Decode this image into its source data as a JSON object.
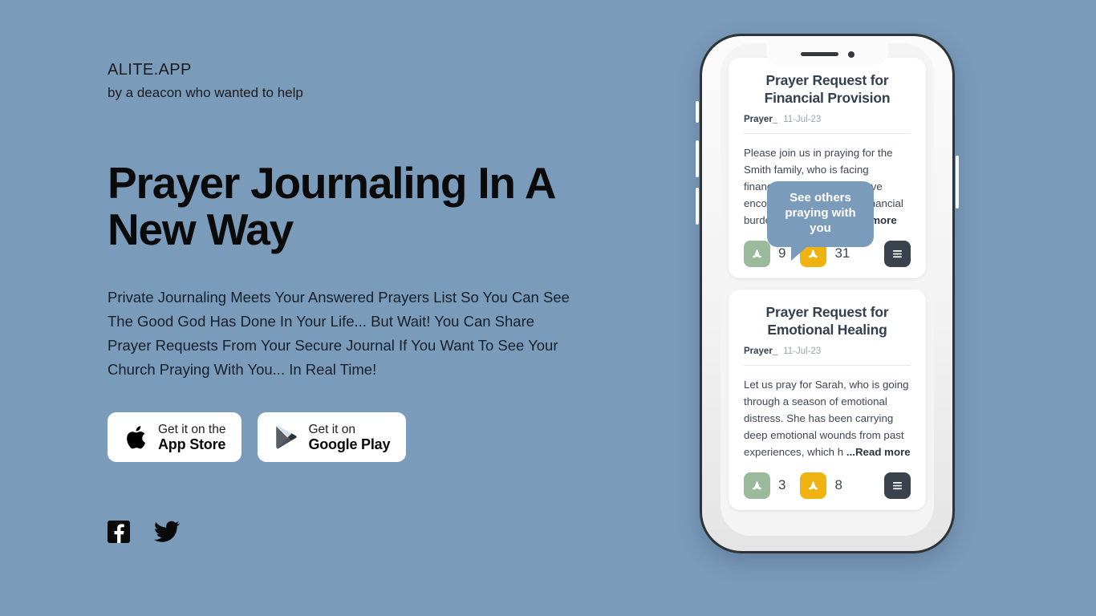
{
  "brand": {
    "name": "ALITE.APP",
    "tagline": "by a deacon who wanted to help"
  },
  "hero": {
    "title": "Prayer Journaling In A New Way",
    "body": "Private Journaling Meets Your Answered Prayers List So You Can See The Good God Has Done In Your Life... But Wait! You Can Share Prayer Requests From Your Secure Journal If You Want To See Your Church Praying With You... In Real Time!"
  },
  "store_buttons": [
    {
      "icon": "apple-icon",
      "small_label": "Get it on the",
      "big_label": "App Store"
    },
    {
      "icon": "google-play-icon",
      "small_label": "Get it on",
      "big_label": "Google Play"
    }
  ],
  "social": [
    {
      "icon": "facebook-icon",
      "name": "Facebook"
    },
    {
      "icon": "twitter-icon",
      "name": "Twitter"
    }
  ],
  "tooltip": {
    "text": "See others praying with you",
    "color": "#7b9bbb"
  },
  "phone": {
    "notch_icons": [
      "speaker-bar",
      "front-camera-dot"
    ],
    "side_buttons": [
      "silent-switch",
      "volume-up",
      "volume-down",
      "power-button"
    ]
  },
  "feed": {
    "cards": [
      {
        "title": "Prayer Request for Financial Provision",
        "author": "Prayer_",
        "date": "11-Jul-23",
        "body": "Please join us in praying for the Smith family, who is facing financial hardship. They have encountered unexpected financial burdens and need ",
        "read_more": "...Read more",
        "reactions": [
          {
            "icon": "praying-hands-icon",
            "color": "#9bba9b",
            "count": "9"
          },
          {
            "icon": "praying-hands-icon",
            "color": "#eeb211",
            "count": "31"
          }
        ],
        "menu_icon": "hamburger-menu-icon"
      },
      {
        "title": "Prayer Request for Emotional Healing",
        "author": "Prayer_",
        "date": "11-Jul-23",
        "body": "Let us pray for Sarah, who is going through a season of emotional distress. She has been carrying deep emotional wounds from past experiences, which h ",
        "read_more": "...Read more",
        "reactions": [
          {
            "icon": "praying-hands-icon",
            "color": "#9bba9b",
            "count": "3"
          },
          {
            "icon": "praying-hands-icon",
            "color": "#eeb211",
            "count": "8"
          }
        ],
        "menu_icon": "hamburger-menu-icon"
      }
    ]
  },
  "colors": {
    "background": "#7b9bbb",
    "card": "#ffffff",
    "accent_green": "#9bba9b",
    "accent_amber": "#eeb211",
    "dark": "#3a424e"
  }
}
